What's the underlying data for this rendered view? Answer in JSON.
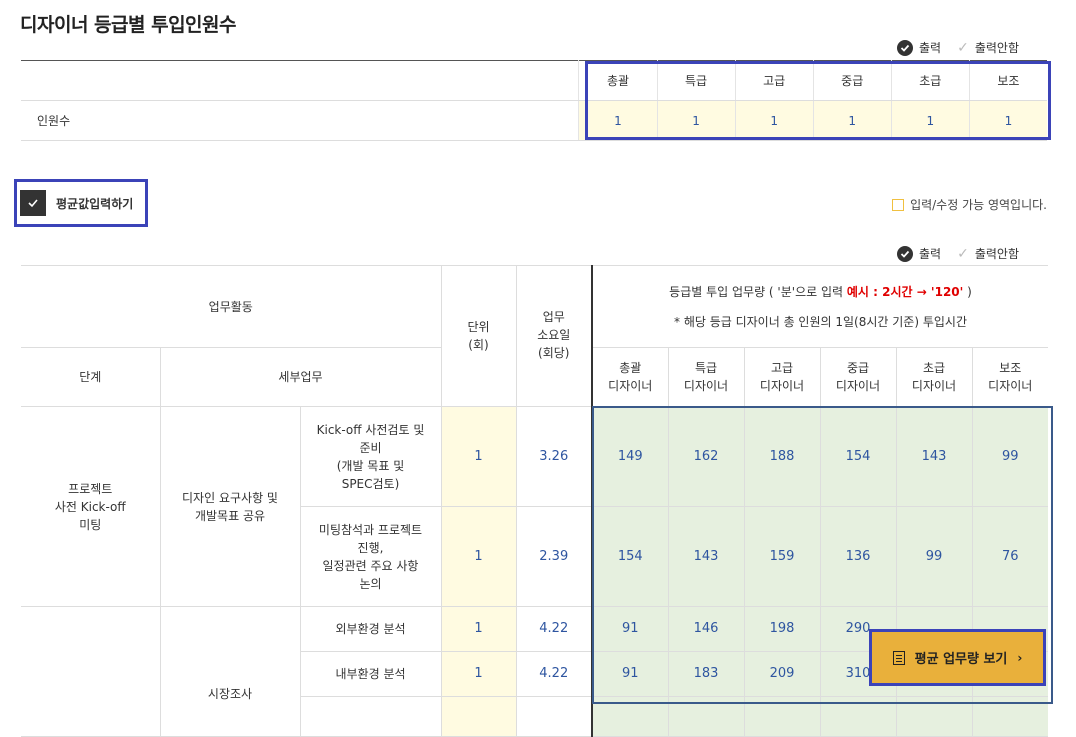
{
  "page": {
    "title": "디자이너 등급별 투입인원수"
  },
  "legend": {
    "print_label": "출력",
    "noprint_label": "출력안함"
  },
  "headcount": {
    "headers": [
      "총괄",
      "특급",
      "고급",
      "중급",
      "초급",
      "보조"
    ],
    "row_label": "인원수",
    "values": [
      "1",
      "1",
      "1",
      "1",
      "1",
      "1"
    ]
  },
  "avg_input": {
    "label": "평균값입력하기"
  },
  "note": {
    "text": "입력/수정 가능 영역입니다."
  },
  "work": {
    "h_activity": "업무활동",
    "h_unit": "단위\n(회)",
    "h_required": "업무\n소요일\n(회당)",
    "h_grade_line1_pre": "등급별 투입 업무량 ( '분'으로 입력 ",
    "h_grade_line1_red": "예시 : 2시간 → '120'",
    "h_grade_line1_post": " )",
    "h_grade_line2": "* 해당 등급 디자이너 총 인원의 1일(8시간 기준) 투입시간",
    "h_stage": "단계",
    "h_detail": "세부업무",
    "grade_cols": [
      "총괄\n디자이너",
      "특급\n디자이너",
      "고급\n디자이너",
      "중급\n디자이너",
      "초급\n디자이너",
      "보조\n디자이너"
    ],
    "rows": [
      {
        "stage": "프로젝트\n사전 Kick-off\n미팅",
        "detail": "디자인 요구사항 및\n개발목표 공유",
        "task": "Kick-off 사전검토 및\n준비\n(개발 목표 및\nSPEC검토)",
        "unit": "1",
        "days": "3.26",
        "vals": [
          "149",
          "162",
          "188",
          "154",
          "143",
          "99"
        ]
      },
      {
        "task": "미팅참석과 프로젝트\n진행,\n일정관련 주요 사항\n논의",
        "unit": "1",
        "days": "2.39",
        "vals": [
          "154",
          "143",
          "159",
          "136",
          "99",
          "76"
        ]
      },
      {
        "stage": "",
        "detail": "시장조사",
        "task": "외부환경 분석",
        "unit": "1",
        "days": "4.22",
        "vals": [
          "91",
          "146",
          "198",
          "290",
          "",
          ""
        ]
      },
      {
        "task": "내부환경 분석",
        "unit": "1",
        "days": "4.22",
        "vals": [
          "91",
          "183",
          "209",
          "310",
          "",
          ""
        ]
      }
    ]
  },
  "avg_button": {
    "label": "평균 업무량 보기",
    "arrow": "›"
  }
}
